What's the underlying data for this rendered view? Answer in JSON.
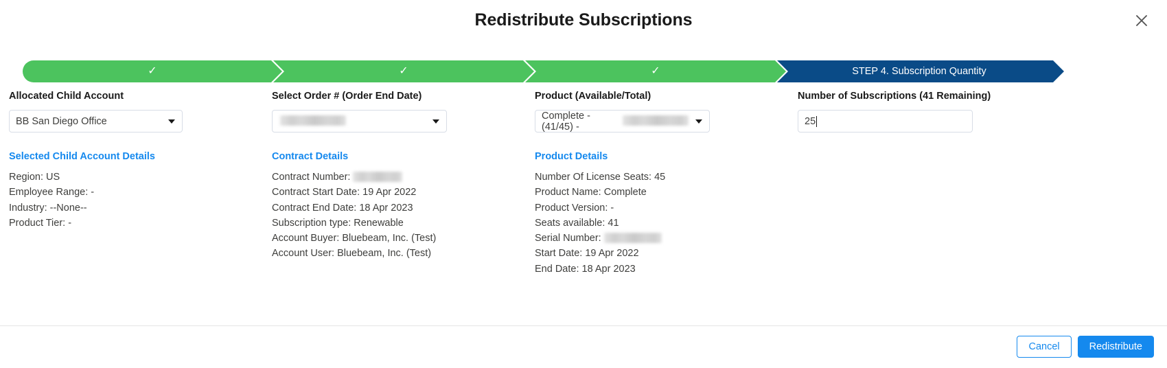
{
  "modal": {
    "title": "Redistribute Subscriptions",
    "close_icon": "close-icon"
  },
  "stepper": {
    "steps": [
      {
        "state": "done",
        "label": "",
        "check": "✓"
      },
      {
        "state": "done",
        "label": "",
        "check": "✓"
      },
      {
        "state": "done",
        "label": "",
        "check": "✓"
      },
      {
        "state": "active",
        "label": "STEP 4. Subscription Quantity",
        "check": ""
      }
    ],
    "colors": {
      "done": "#4cc35e",
      "active": "#0a4b87"
    }
  },
  "fields": {
    "child_account": {
      "label": "Allocated Child Account",
      "value": "BB San Diego Office"
    },
    "order": {
      "label": "Select Order # (Order End Date)",
      "value": "",
      "redacted": true
    },
    "product": {
      "label": "Product (Available/Total)",
      "value": "Complete - (41/45) -",
      "redacted": true
    },
    "quantity": {
      "label": "Number of Subscriptions (41 Remaining)",
      "value": "25"
    }
  },
  "details": {
    "child_account": {
      "title": "Selected Child Account Details",
      "lines": [
        "Region: US",
        "Employee Range:  -",
        "Industry: --None--",
        "Product Tier:  -"
      ]
    },
    "contract": {
      "title": "Contract Details",
      "line_contract_number_label": "Contract Number:",
      "lines": [
        "Contract Start Date: 19 Apr 2022",
        "Contract End Date: 18 Apr 2023",
        "Subscription type: Renewable",
        "Account Buyer: Bluebeam, Inc. (Test)",
        "Account User: Bluebeam, Inc. (Test)"
      ]
    },
    "product": {
      "title": "Product Details",
      "lines_before": [
        "Number Of License Seats: 45",
        "Product Name: Complete",
        "Product Version:  -",
        "Seats available: 41"
      ],
      "line_serial_number_label": "Serial Number:",
      "lines_after": [
        "Start Date: 19 Apr 2022",
        "End Date: 18 Apr 2023"
      ]
    }
  },
  "footer": {
    "cancel_label": "Cancel",
    "submit_label": "Redistribute"
  },
  "colors": {
    "link": "#1589ee",
    "primary": "#1589ee",
    "step_done": "#4cc35e",
    "step_active": "#0a4b87"
  }
}
